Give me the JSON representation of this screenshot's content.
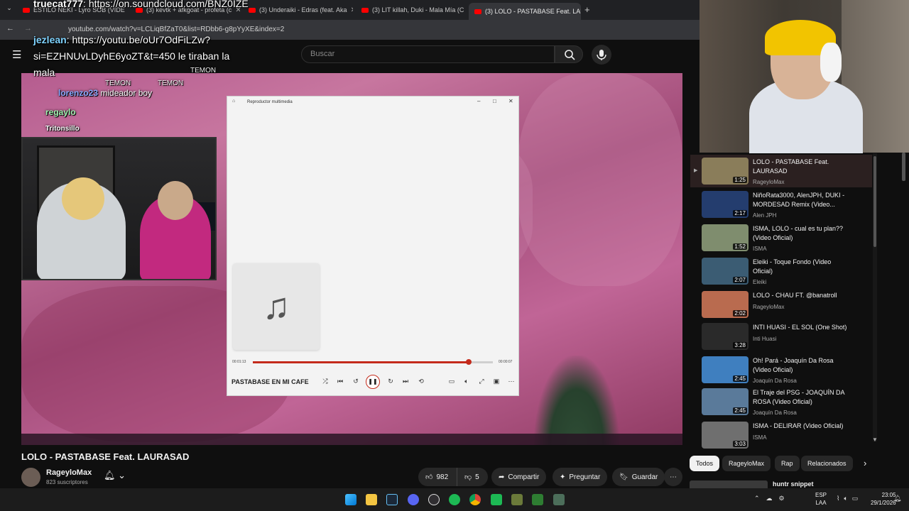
{
  "browser": {
    "tabs": [
      {
        "label": "ESTILO NEKI - Lyro SOB (VIDE"
      },
      {
        "label": "(3) kevtk + afkgoat - profeta (c"
      },
      {
        "label": "(3) Underaiki - Edras (feat. Aka"
      },
      {
        "label": "(3) LIT killah, Duki - Mala Mía (C"
      },
      {
        "label": "(3) LOLO - PASTABASE Feat. LAU"
      }
    ],
    "url": "youtube.com/watch?v=LCLiqBfZaT0&list=RDbb6-g8pYyXE&index=2"
  },
  "youtube": {
    "search_placeholder": "Buscar",
    "video_title": "LOLO - PASTABASE Feat. LAURASAD",
    "channel": "RageyloMax",
    "subscribers": "823 suscriptores",
    "likes": "982",
    "dislikes": "5",
    "share": "Compartir",
    "ask": "Preguntar",
    "save": "Guardar",
    "chips": [
      "Todos",
      "RageyloMax",
      "Rap",
      "Relacionados"
    ],
    "next_item": "huntr snippet",
    "playlist": [
      {
        "title": "LOLO - PASTABASE Feat. LAURASAD",
        "channel": "RageyloMax",
        "duration": "1:25",
        "color": "#8a7d5a"
      },
      {
        "title": "NiñoRata3000, AlenJPH, DUKI - MORDESAD Remix (Video...",
        "channel": "Alen JPH",
        "duration": "2:17",
        "color": "#243d6e"
      },
      {
        "title": "ISMA, LOLO - cual es tu plan?? (Video Oficial)",
        "channel": "ISMA",
        "duration": "1:52",
        "color": "#7f8d6e"
      },
      {
        "title": "Eleiki - Toque Fondo (Video Oficial)",
        "channel": "Eleiki",
        "duration": "2:07",
        "color": "#3b5c73"
      },
      {
        "title": "LOLO - CHAU FT. @banatroll",
        "channel": "RageyloMax",
        "duration": "2:02",
        "color": "#b96b4f"
      },
      {
        "title": "INTI HUASI - EL SOL (One Shot)",
        "channel": "Inti Huasi",
        "duration": "3:28",
        "color": "#2a2a2a"
      },
      {
        "title": "Oh! Pará - Joaquín Da Rosa (Video Oficial)",
        "channel": "Joaquín Da Rosa",
        "duration": "2:45",
        "color": "#3f7fbf"
      },
      {
        "title": "El Traje del PSG - JOAQUÍN DA ROSA (Video Oficial)",
        "channel": "Joaquín Da Rosa",
        "duration": "2:45",
        "color": "#5a7a9a"
      },
      {
        "title": "ISMA - DELIRAR (Video Oficial)",
        "channel": "ISMA",
        "duration": "3:03",
        "color": "#6f6f6f"
      }
    ]
  },
  "stream_overlay": {
    "chat": [
      {
        "user": "truecat777",
        "text": "https://on.soundcloud.com/BNZ0IZE"
      },
      {
        "user": "jezlean",
        "text": "https://youtu.be/oUr7OdFiLZw?"
      },
      {
        "user": "",
        "text": "si=EZHNUvLDyhE6yoZT&t=450 le tiraban la"
      },
      {
        "user": "",
        "text": "mala"
      },
      {
        "user": "lorenzo23",
        "text": "mideador boy"
      },
      {
        "user": "regaylo",
        "text": ""
      },
      {
        "user": "Tritonsillo",
        "text": ""
      }
    ],
    "ticker": [
      "TEMON",
      "TEMON",
      "TEMON"
    ]
  },
  "media_player": {
    "app_title": "Reproductor multimedia",
    "track": "PASTABASE EN MI CAFE",
    "elapsed": "00:01:13",
    "remaining": "00:00:07",
    "progress_fraction": 0.9
  },
  "system": {
    "lang": "ESP",
    "lang2": "LAA",
    "time": "23:05",
    "date": "29/1/2026"
  },
  "colors": {
    "yt_red": "#ff0000",
    "player_accent": "#c42b1c"
  }
}
